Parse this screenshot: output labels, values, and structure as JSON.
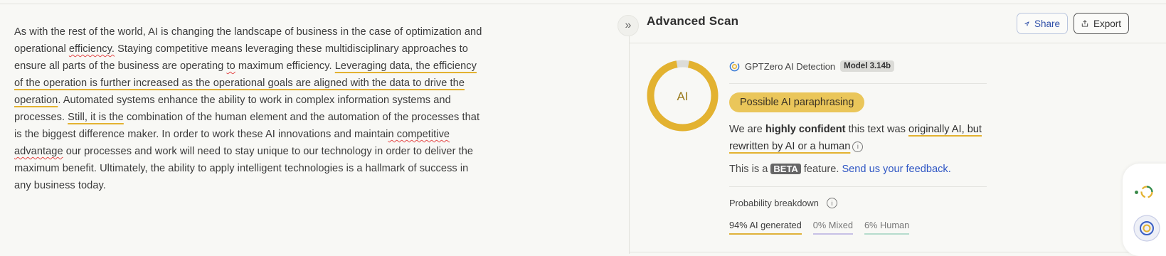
{
  "editor": {
    "seg1": "As with the rest of the world, AI is changing the landscape of business in the case of optimization and operational ",
    "seg2": "efficiency.",
    "seg3": " Staying competitive means leveraging these multidisciplinary approaches to ensure all parts of the business are operating ",
    "seg4": "to",
    "seg5": " maximum efficiency. ",
    "seg6": "Leveraging data, the efficiency of the operation is further increased as the operational goals are aligned with the data to drive the operation",
    "seg7": ". Automated systems enhance the ability to work in complex information systems and processes. ",
    "seg8": "Still, it is the",
    "seg9": " combination of the human element and the automation of the processes that is the biggest difference maker. In order to work these AI innovations and maintai",
    "seg10": "n competitive",
    "seg11": " ",
    "seg12": "advantage",
    "seg13": " our processes and work will need to stay unique to our technology in order to deliver the maximum benefit. Ultimately, the ability to apply intelligent technologies is a hallmark of success in any business today."
  },
  "panel": {
    "title": "Advanced Scan",
    "share_label": "Share",
    "export_label": "Export",
    "collapse_icon": "double-chevron-right-icon"
  },
  "result": {
    "donut_label": "AI",
    "donut_ai_fraction": 0.94,
    "brand": "GPTZero AI Detection",
    "model": "Model 3.14b",
    "verdict": "Possible AI paraphrasing",
    "conf_1": "We are ",
    "conf_2": "highly confident",
    "conf_3": " this text was ",
    "conf_4": "originally AI, but rewritten by AI or a human",
    "beta_1": "This is a ",
    "beta_tag": "BETA",
    "beta_2": " feature. ",
    "feedback": "Send us your feedback.",
    "prob_title": "Probability breakdown",
    "ai_generated": "94% AI generated",
    "mixed": "0% Mixed",
    "human": "6% Human"
  },
  "colors": {
    "ai_yellow": "#e3b230",
    "pill": "#eac65a",
    "link_blue": "#2f56c4",
    "mixed_purple": "#c7c1e6",
    "human_green": "#b6dccd"
  }
}
